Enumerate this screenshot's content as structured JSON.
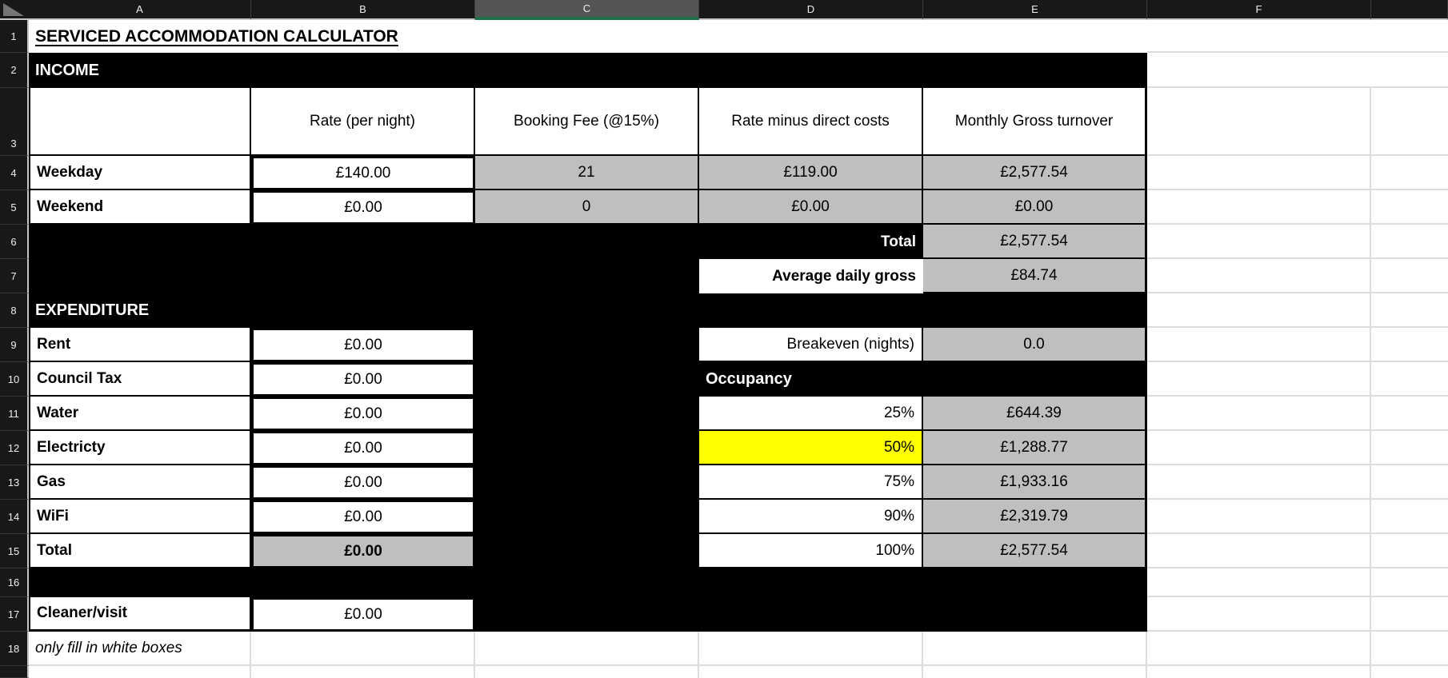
{
  "sheet": {
    "selected_column": "C",
    "column_headers": [
      "A",
      "B",
      "C",
      "D",
      "E",
      "F"
    ],
    "row_headers": [
      "1",
      "2",
      "3",
      "4",
      "5",
      "6",
      "7",
      "8",
      "9",
      "10",
      "11",
      "12",
      "13",
      "14",
      "15",
      "16",
      "17",
      "18"
    ]
  },
  "title": "SERVICED ACCOMMODATION CALCULATOR",
  "income": {
    "label": "INCOME",
    "headers": {
      "rate": "Rate (per night)",
      "booking_fee": "Booking Fee (@15%)",
      "rate_minus_costs": "Rate minus direct costs",
      "monthly_gross": "Monthly Gross turnover"
    },
    "rows": [
      {
        "label": "Weekday",
        "rate": "£140.00",
        "booking_fee": "21",
        "rate_minus_costs": "£119.00",
        "monthly_gross": "£2,577.54"
      },
      {
        "label": "Weekend",
        "rate": "£0.00",
        "booking_fee": "0",
        "rate_minus_costs": "£0.00",
        "monthly_gross": "£0.00"
      }
    ],
    "total": {
      "label": "Total",
      "value": "£2,577.54"
    },
    "average_daily_gross": {
      "label": "Average daily gross",
      "value": "£84.74"
    }
  },
  "expenditure": {
    "label": "EXPENDITURE",
    "items": [
      {
        "label": "Rent",
        "value": "£0.00"
      },
      {
        "label": "Council Tax",
        "value": "£0.00"
      },
      {
        "label": "Water",
        "value": "£0.00"
      },
      {
        "label": "Electricty",
        "value": "£0.00"
      },
      {
        "label": "Gas",
        "value": "£0.00"
      },
      {
        "label": "WiFi",
        "value": "£0.00"
      }
    ],
    "total": {
      "label": "Total",
      "value": "£0.00"
    },
    "cleaner": {
      "label": "Cleaner/visit",
      "value": "£0.00"
    }
  },
  "analysis": {
    "breakeven": {
      "label": "Breakeven (nights)",
      "value": "0.0"
    },
    "occupancy": {
      "label": "Occupancy",
      "rows": [
        {
          "pct": "25%",
          "value": "£644.39",
          "highlighted": false
        },
        {
          "pct": "50%",
          "value": "£1,288.77",
          "highlighted": true
        },
        {
          "pct": "75%",
          "value": "£1,933.16",
          "highlighted": false
        },
        {
          "pct": "90%",
          "value": "£2,319.79",
          "highlighted": false
        },
        {
          "pct": "100%",
          "value": "£2,577.54",
          "highlighted": false
        }
      ]
    }
  },
  "footnote": "only fill in white boxes",
  "colors": {
    "header_bg": "#181818",
    "selected_header_bg": "#555555",
    "selected_column_green": "#1f7145",
    "cell_gray": "#bfbfbf",
    "highlight_yellow": "#ffff00",
    "gridline": "#dcdcdc"
  }
}
